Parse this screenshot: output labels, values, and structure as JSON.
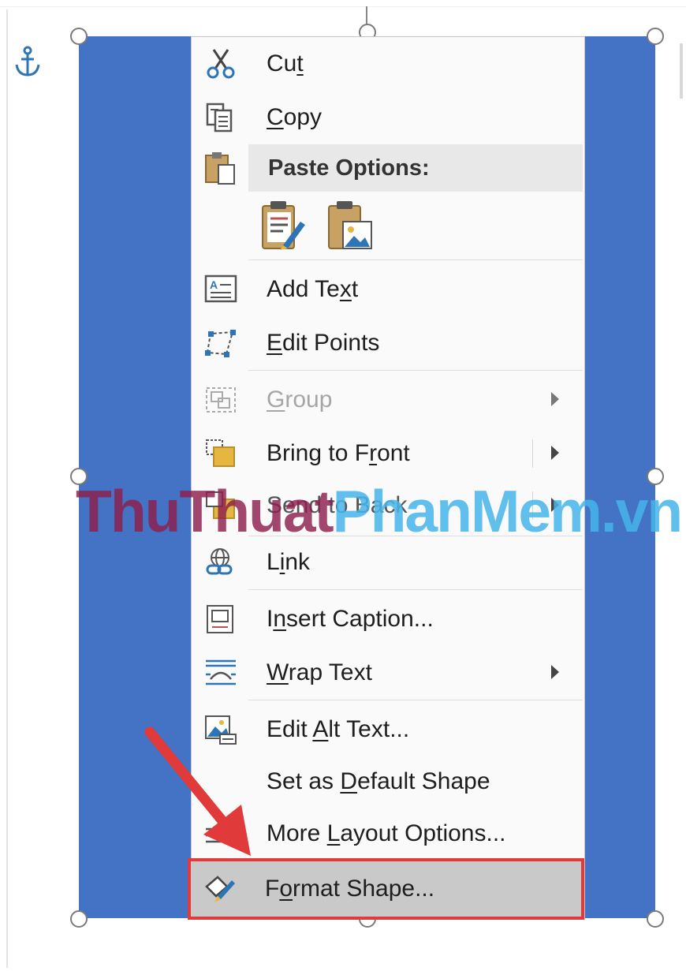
{
  "colors": {
    "shape_fill": "#4472c4",
    "menu_bg": "#fafafa",
    "highlight_border": "#e03a3a",
    "arrow": "#e03a3a",
    "watermark_dark": "#8e1f4d",
    "watermark_light": "#46b5ea"
  },
  "menu": {
    "cut": {
      "before": "Cu",
      "ul": "t",
      "after": "",
      "icon": "scissors-icon"
    },
    "copy": {
      "before": "",
      "ul": "C",
      "after": "opy",
      "icon": "copy-icon"
    },
    "paste_options": {
      "label": "Paste Options:",
      "icon": "clipboard-icon"
    },
    "paste_buttons": [
      {
        "icon": "paste-keep-formatting-icon"
      },
      {
        "icon": "paste-picture-icon"
      }
    ],
    "add_text": {
      "before": "Add Te",
      "ul": "x",
      "after": "t",
      "icon": "add-text-icon"
    },
    "edit_points": {
      "before": "",
      "ul": "E",
      "after": "dit Points",
      "icon": "edit-points-icon"
    },
    "group": {
      "before": "",
      "ul": "G",
      "after": "roup",
      "icon": "group-icon",
      "disabled": true
    },
    "bring_to_front": {
      "before": "Bring to F",
      "ul": "r",
      "after": "ont",
      "icon": "bring-to-front-icon"
    },
    "send_to_back": {
      "label": "Send to Back",
      "icon": "send-to-back-icon"
    },
    "link": {
      "before": "L",
      "ul": "i",
      "after": "nk",
      "icon": "link-icon"
    },
    "insert_caption": {
      "before": "I",
      "ul": "n",
      "after": "sert Caption...",
      "icon": "insert-caption-icon"
    },
    "wrap_text": {
      "before": "",
      "ul": "W",
      "after": "rap Text",
      "icon": "wrap-text-icon"
    },
    "edit_alt_text": {
      "before": "Edit ",
      "ul": "A",
      "after": "lt Text...",
      "icon": "alt-text-icon"
    },
    "set_default": {
      "before": "Set as ",
      "ul": "D",
      "after": "efault Shape"
    },
    "more_layout": {
      "before": "More ",
      "ul": "L",
      "after": "ayout Options...",
      "icon": "layout-options-icon"
    },
    "format_shape": {
      "before": "F",
      "ul": "o",
      "after": "rmat Shape...",
      "icon": "format-shape-icon"
    }
  },
  "watermark": {
    "part1": "ThuThuat",
    "part2": "PhanMem.vn"
  }
}
